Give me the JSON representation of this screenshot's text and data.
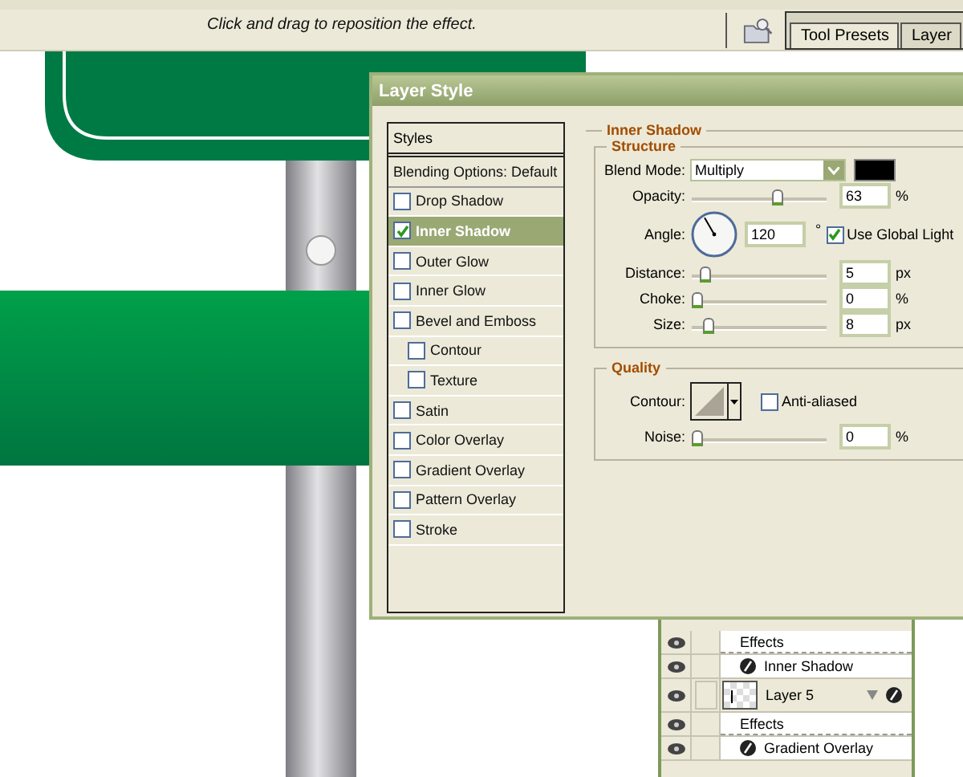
{
  "options_bar": {
    "hint": "Click and drag to reposition the effect.",
    "palette_tabs": [
      {
        "label": "Tool Presets",
        "selected": true
      },
      {
        "label": "Layer",
        "selected": false
      }
    ]
  },
  "dialog": {
    "title": "Layer Style",
    "styles_list": {
      "header": "Styles",
      "blending": "Blending Options: Default",
      "items": [
        {
          "label": "Drop Shadow",
          "checked": false,
          "selected": false
        },
        {
          "label": "Inner Shadow",
          "checked": true,
          "selected": true
        },
        {
          "label": "Outer Glow",
          "checked": false,
          "selected": false
        },
        {
          "label": "Inner Glow",
          "checked": false,
          "selected": false
        },
        {
          "label": "Bevel and Emboss",
          "checked": false,
          "selected": false,
          "children": [
            {
              "label": "Contour",
              "checked": false,
              "selected": false
            },
            {
              "label": "Texture",
              "checked": false,
              "selected": false
            }
          ]
        },
        {
          "label": "Satin",
          "checked": false,
          "selected": false
        },
        {
          "label": "Color Overlay",
          "checked": false,
          "selected": false
        },
        {
          "label": "Gradient Overlay",
          "checked": false,
          "selected": false
        },
        {
          "label": "Pattern Overlay",
          "checked": false,
          "selected": false
        },
        {
          "label": "Stroke",
          "checked": false,
          "selected": false
        }
      ]
    },
    "effect": {
      "title": "Inner Shadow",
      "structure": {
        "title": "Structure",
        "blend_mode": {
          "label": "Blend Mode:",
          "value": "Multiply",
          "color": "#000000"
        },
        "opacity": {
          "label": "Opacity:",
          "level": 0.65,
          "value": "63",
          "unit": "%"
        },
        "angle": {
          "label": "Angle:",
          "value": "120",
          "unit": "°",
          "global_light": {
            "label": "Use Global Light",
            "checked": true
          }
        },
        "sliders": [
          {
            "label": "Distance:",
            "level": 0.06,
            "value": "5",
            "unit": "px"
          },
          {
            "label": "Choke:",
            "level": 0,
            "value": "0",
            "unit": "%"
          },
          {
            "label": "Size:",
            "level": 0.09,
            "value": "8",
            "unit": "px"
          }
        ]
      },
      "quality": {
        "title": "Quality",
        "contour": {
          "label": "Contour:"
        },
        "anti_aliased": {
          "label": "Anti-aliased",
          "checked": false
        },
        "noise": {
          "label": "Noise:",
          "level": 0,
          "value": "0",
          "unit": "%"
        }
      }
    }
  },
  "layers_panel": {
    "rows": [
      {
        "kind": "effects",
        "label": "Effects"
      },
      {
        "kind": "effect",
        "label": "Inner Shadow"
      },
      {
        "kind": "layer",
        "label": "Layer 5"
      },
      {
        "kind": "effects",
        "label": "Effects"
      },
      {
        "kind": "effect",
        "label": "Gradient Overlay"
      }
    ]
  }
}
